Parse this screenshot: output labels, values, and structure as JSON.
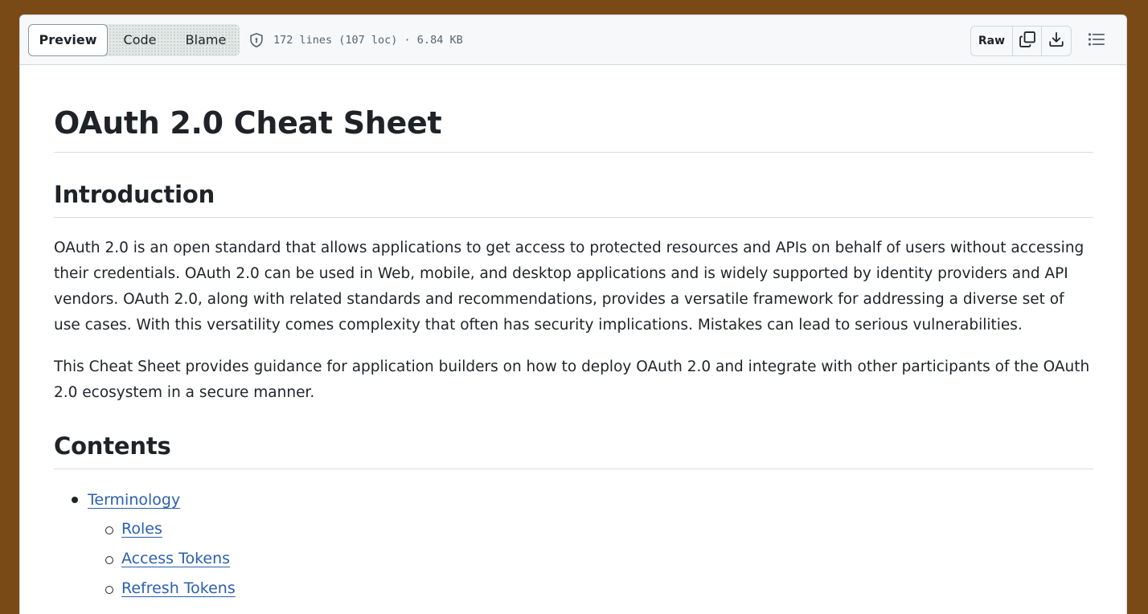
{
  "toolbar": {
    "tabs": [
      {
        "label": "Preview",
        "active": true
      },
      {
        "label": "Code",
        "active": false
      },
      {
        "label": "Blame",
        "active": false
      }
    ],
    "file_info": "172 lines (107 loc) · 6.84 KB",
    "raw_label": "Raw",
    "icons": [
      "shield-icon",
      "copy-icon",
      "download-icon",
      "list-icon"
    ]
  },
  "doc": {
    "title": "OAuth 2.0 Cheat Sheet",
    "intro_heading": "Introduction",
    "paragraph1": "OAuth 2.0 is an open standard that allows applications to get access to protected resources and APIs on behalf of users without accessing their credentials. OAuth 2.0 can be used in Web, mobile, and desktop applications and is widely supported by identity providers and API vendors. OAuth 2.0, along with related standards and recommendations, provides a versatile framework for addressing a diverse set of use cases. With this versatility comes complexity that often has security implications. Mistakes can lead to serious vulnerabilities.",
    "paragraph2": "This Cheat Sheet provides guidance for application builders on how to deploy OAuth 2.0 and integrate with other participants of the OAuth 2.0 ecosystem in a secure manner.",
    "contents_heading": "Contents",
    "toc": {
      "item": "Terminology",
      "subitems": [
        "Roles",
        "Access Tokens",
        "Refresh Tokens"
      ]
    }
  },
  "colors": {
    "frame_border": "#7a4a16",
    "link": "#2a5fb0",
    "text": "#1f2328",
    "muted": "#59636e"
  }
}
